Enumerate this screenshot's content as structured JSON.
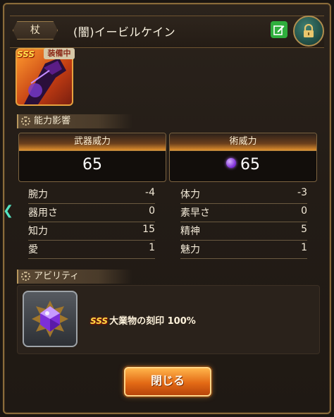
{
  "header": {
    "category": "杖",
    "item_name": "(闇)イービルケイン",
    "equip_badge": "装備中",
    "rarity_mark": "SSS"
  },
  "stats_section": {
    "title": "能力影響",
    "weapon_power": {
      "label": "武器威力",
      "value": "65"
    },
    "art_power": {
      "label": "術威力",
      "value": "65"
    },
    "left": [
      {
        "label": "腕力",
        "value": "-4"
      },
      {
        "label": "器用さ",
        "value": "0"
      },
      {
        "label": "知力",
        "value": "15"
      },
      {
        "label": "愛",
        "value": "1"
      }
    ],
    "right": [
      {
        "label": "体力",
        "value": "-3"
      },
      {
        "label": "素早さ",
        "value": "0"
      },
      {
        "label": "精神",
        "value": "5"
      },
      {
        "label": "魅力",
        "value": "1"
      }
    ]
  },
  "ability_section": {
    "title": "アビリティ",
    "ability_rank": "SSS",
    "ability_name": "大業物の刻印 100%"
  },
  "close_button": "閉じる",
  "icons": [
    "edit-icon",
    "lock-icon",
    "gear-icon",
    "moon-icon",
    "gem-icon",
    "side-arrow-icon"
  ]
}
